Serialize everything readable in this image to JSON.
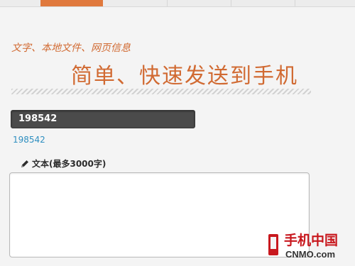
{
  "header": {
    "tabs_count_note": ""
  },
  "hero": {
    "subtitle": "文字、本地文件、网页信息",
    "headline": "简单、快速发送到手机"
  },
  "code": {
    "value": "198542",
    "link_text": "198542"
  },
  "text_input": {
    "label": "文本(最多3000字)",
    "value": "",
    "placeholder": ""
  },
  "watermark": {
    "cn": "手机中国",
    "en": "CNMO.com"
  },
  "colors": {
    "accent": "#d16a32",
    "active_tab": "#e0793d",
    "code_bar": "#4b4b4b",
    "link": "#2f8fc0",
    "watermark_red": "#c8181e"
  }
}
